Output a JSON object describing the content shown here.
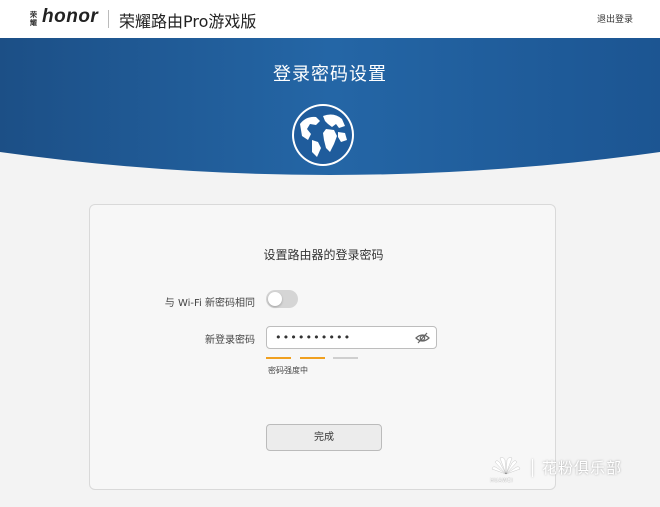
{
  "header": {
    "logo_small": "荣耀",
    "logo_brand": "honor",
    "product_title": "荣耀路由Pro游戏版",
    "logout_label": "退出登录"
  },
  "banner": {
    "title": "登录密码设置",
    "icon": "globe-icon",
    "gradient_colors": [
      "#1c4f86",
      "#2a6fb0"
    ]
  },
  "form": {
    "title": "设置路由器的登录密码",
    "same_as_wifi_label": "与 Wi-Fi 新密码相同",
    "same_as_wifi_enabled": false,
    "new_password_label": "新登录密码",
    "new_password_value": "••••••••••",
    "show_password_icon": "eye-icon",
    "strength_level": 2,
    "strength_segments": 3,
    "strength_active_color": "#f0a020",
    "strength_inactive_color": "#cfcfcf",
    "strength_label": "密码强度中",
    "submit_label": "完成"
  },
  "watermark": {
    "brand": "HUAWEI",
    "text": "花粉俱乐部"
  }
}
